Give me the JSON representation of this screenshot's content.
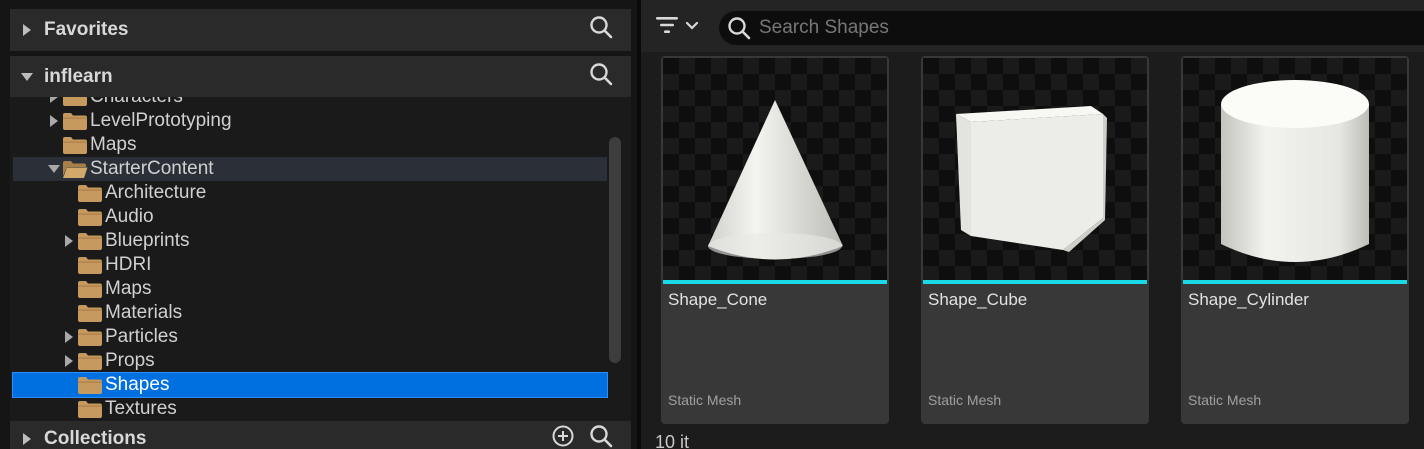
{
  "left_panel": {
    "favorites": {
      "title": "Favorites"
    },
    "project": {
      "title": "inflearn"
    },
    "collections": {
      "title": "Collections"
    },
    "tree": [
      {
        "label": "Characters",
        "depth": 1,
        "expander": "collapsed"
      },
      {
        "label": "LevelPrototyping",
        "depth": 1,
        "expander": "collapsed"
      },
      {
        "label": "Maps",
        "depth": 1,
        "expander": "none"
      },
      {
        "label": "StarterContent",
        "depth": 1,
        "expander": "expanded",
        "state": "open-parent"
      },
      {
        "label": "Architecture",
        "depth": 2,
        "expander": "none"
      },
      {
        "label": "Audio",
        "depth": 2,
        "expander": "none"
      },
      {
        "label": "Blueprints",
        "depth": 2,
        "expander": "collapsed"
      },
      {
        "label": "HDRI",
        "depth": 2,
        "expander": "none"
      },
      {
        "label": "Maps",
        "depth": 2,
        "expander": "none"
      },
      {
        "label": "Materials",
        "depth": 2,
        "expander": "none"
      },
      {
        "label": "Particles",
        "depth": 2,
        "expander": "collapsed"
      },
      {
        "label": "Props",
        "depth": 2,
        "expander": "collapsed"
      },
      {
        "label": "Shapes",
        "depth": 2,
        "expander": "none",
        "state": "selected"
      },
      {
        "label": "Textures",
        "depth": 2,
        "expander": "none"
      }
    ]
  },
  "right_panel": {
    "search": {
      "placeholder": "Search Shapes",
      "value": ""
    },
    "assets": [
      {
        "name": "Shape_Cone",
        "type": "Static Mesh",
        "shape": "cone"
      },
      {
        "name": "Shape_Cube",
        "type": "Static Mesh",
        "shape": "cube"
      },
      {
        "name": "Shape_Cylinder",
        "type": "Static Mesh",
        "shape": "cylinder"
      }
    ],
    "status": "10 it"
  },
  "colors": {
    "selection": "#0070e0",
    "asset_bar": "#19d9e6",
    "folder": "#c69a5e"
  },
  "icons": [
    "search-icon",
    "filter-icon",
    "chevron-down-icon",
    "add-circle-icon",
    "folder-icon",
    "folder-open-icon",
    "triangle-right-icon",
    "triangle-down-icon"
  ]
}
